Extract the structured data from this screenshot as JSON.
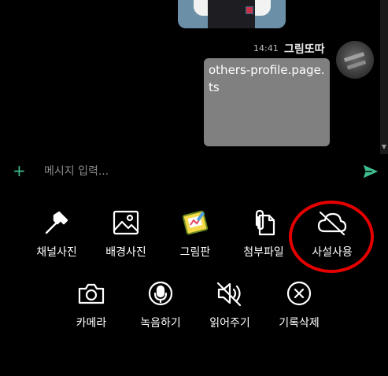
{
  "chat": {
    "time": "14:41",
    "sender": "그림또따",
    "message": "others-profile.page.ts"
  },
  "input": {
    "placeholder": "메시지 입력..."
  },
  "toolbar_row1": [
    {
      "label": "채널사진",
      "icon": "hammer-icon"
    },
    {
      "label": "배경사진",
      "icon": "image-icon"
    },
    {
      "label": "그림판",
      "icon": "drawing-board-icon"
    },
    {
      "label": "첨부파일",
      "icon": "paperclip-file-icon"
    },
    {
      "label": "사설사용",
      "icon": "cloud-off-icon"
    }
  ],
  "toolbar_row2": [
    {
      "label": "카메라",
      "icon": "camera-icon"
    },
    {
      "label": "녹음하기",
      "icon": "microphone-icon"
    },
    {
      "label": "읽어주기",
      "icon": "speaker-mute-icon"
    },
    {
      "label": "기록삭제",
      "icon": "close-circle-icon"
    }
  ],
  "colors": {
    "accent": "#3fbf8f",
    "bubble": "#808080",
    "highlight": "#e50000"
  }
}
